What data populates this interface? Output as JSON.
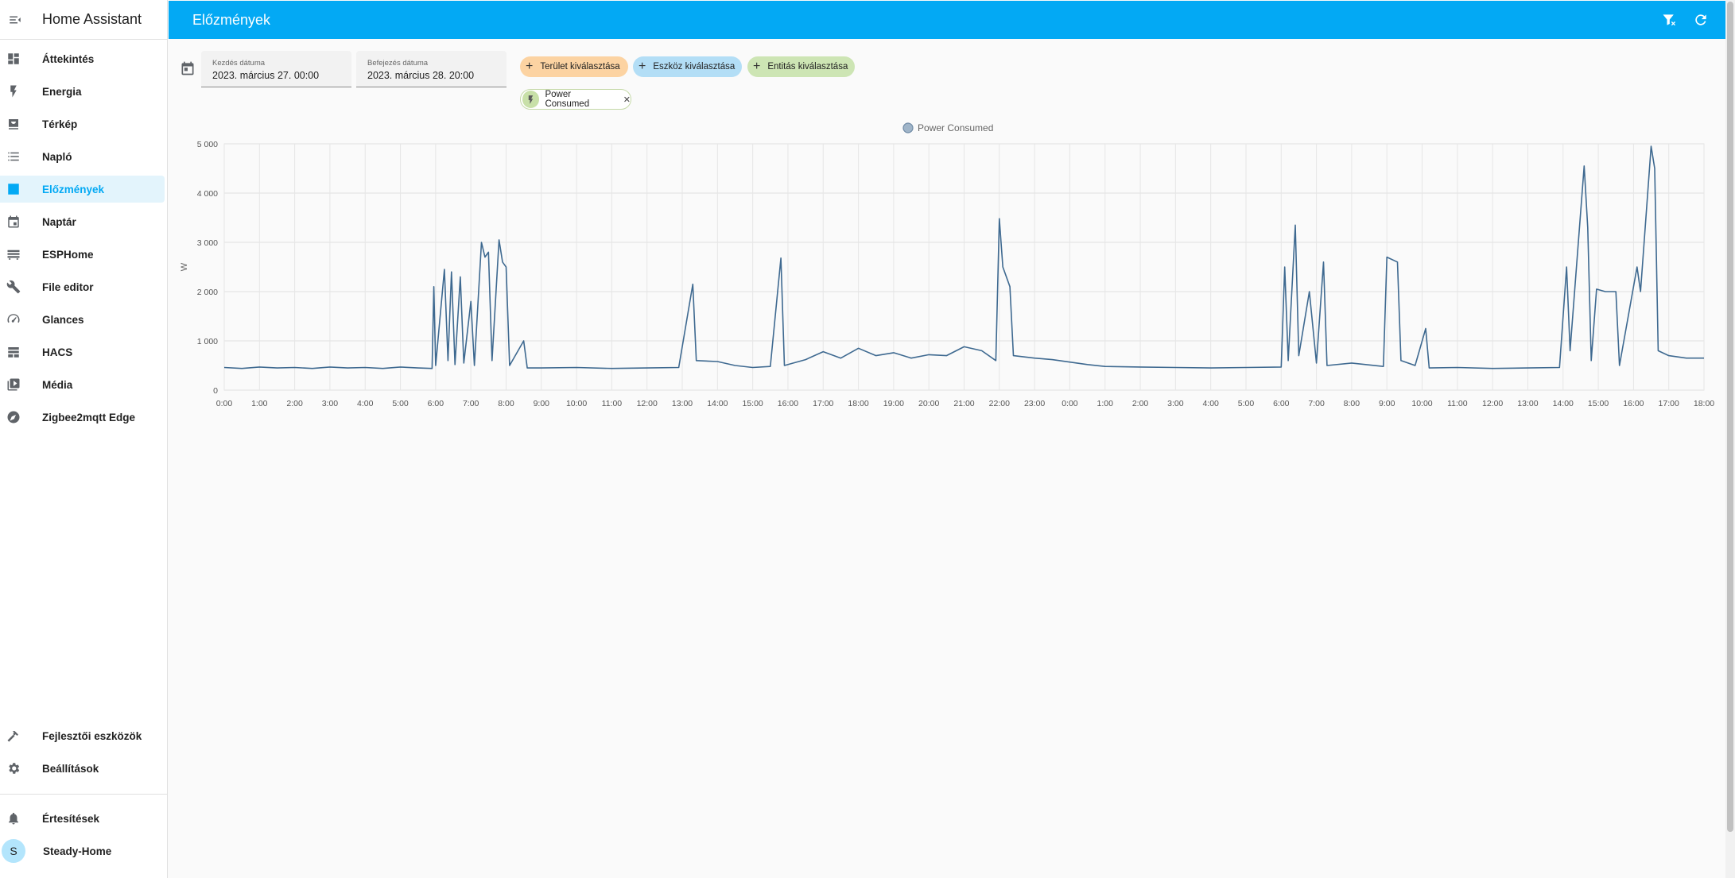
{
  "app": {
    "title": "Home Assistant"
  },
  "sidebar": {
    "items": [
      {
        "label": "Áttekintés",
        "icon": "dashboard-icon",
        "active": false
      },
      {
        "label": "Energia",
        "icon": "lightning-icon",
        "active": false
      },
      {
        "label": "Térkép",
        "icon": "map-icon",
        "active": false
      },
      {
        "label": "Napló",
        "icon": "list-icon",
        "active": false
      },
      {
        "label": "Előzmények",
        "icon": "chart-icon",
        "active": true
      },
      {
        "label": "Naptár",
        "icon": "calendar-icon",
        "active": false
      },
      {
        "label": "ESPHome",
        "icon": "chip-icon",
        "active": false
      },
      {
        "label": "File editor",
        "icon": "wrench-icon",
        "active": false
      },
      {
        "label": "Glances",
        "icon": "gauge-icon",
        "active": false
      },
      {
        "label": "HACS",
        "icon": "hacs-icon",
        "active": false
      },
      {
        "label": "Média",
        "icon": "media-icon",
        "active": false
      },
      {
        "label": "Zigbee2mqtt Edge",
        "icon": "compass-icon",
        "active": false
      }
    ],
    "bottom": [
      {
        "label": "Fejlesztői eszközök",
        "icon": "hammer-icon"
      },
      {
        "label": "Beállítások",
        "icon": "gear-icon"
      }
    ],
    "notifications_label": "Értesítések",
    "user": {
      "initial": "S",
      "name": "Steady-Home"
    }
  },
  "header": {
    "title": "Előzmények"
  },
  "filters": {
    "start": {
      "label": "Kezdés dátuma",
      "value": "2023. március 27. 00:00"
    },
    "end": {
      "label": "Befejezés dátuma",
      "value": "2023. március 28. 20:00"
    },
    "chips": {
      "area": "Terület kiválasztása",
      "device": "Eszköz kiválasztása",
      "entity": "Entitás kiválasztása"
    },
    "selected_entity": "Power Consumed"
  },
  "colors": {
    "accent": "#03a9f4",
    "series": "#3e6990"
  },
  "chart_data": {
    "type": "line",
    "ylabel": "W",
    "ylim": [
      0,
      5000
    ],
    "yticks": [
      "0",
      "1 000",
      "2 000",
      "3 000",
      "4 000",
      "5 000"
    ],
    "xticks": [
      "0:00",
      "1:00",
      "2:00",
      "3:00",
      "4:00",
      "5:00",
      "6:00",
      "7:00",
      "8:00",
      "9:00",
      "10:00",
      "11:00",
      "12:00",
      "13:00",
      "14:00",
      "15:00",
      "16:00",
      "17:00",
      "18:00",
      "19:00",
      "20:00",
      "21:00",
      "22:00",
      "23:00",
      "0:00",
      "1:00",
      "2:00",
      "3:00",
      "4:00",
      "5:00",
      "6:00",
      "7:00",
      "8:00",
      "9:00",
      "10:00",
      "11:00",
      "12:00",
      "13:00",
      "14:00",
      "15:00",
      "16:00",
      "17:00",
      "18:00"
    ],
    "grid": true,
    "legend_position": "top-center",
    "series": [
      {
        "name": "Power Consumed",
        "points": [
          [
            0,
            460
          ],
          [
            0.5,
            440
          ],
          [
            1,
            470
          ],
          [
            1.5,
            450
          ],
          [
            2,
            460
          ],
          [
            2.5,
            440
          ],
          [
            3,
            470
          ],
          [
            3.5,
            450
          ],
          [
            4,
            460
          ],
          [
            4.5,
            440
          ],
          [
            5,
            470
          ],
          [
            5.5,
            450
          ],
          [
            5.9,
            440
          ],
          [
            5.95,
            2100
          ],
          [
            6.0,
            500
          ],
          [
            6.25,
            2450
          ],
          [
            6.35,
            600
          ],
          [
            6.45,
            2400
          ],
          [
            6.55,
            520
          ],
          [
            6.7,
            2300
          ],
          [
            6.8,
            550
          ],
          [
            7.0,
            1800
          ],
          [
            7.1,
            500
          ],
          [
            7.3,
            3000
          ],
          [
            7.4,
            2700
          ],
          [
            7.5,
            2800
          ],
          [
            7.6,
            600
          ],
          [
            7.8,
            3050
          ],
          [
            7.9,
            2600
          ],
          [
            8.0,
            2500
          ],
          [
            8.1,
            500
          ],
          [
            8.5,
            1000
          ],
          [
            8.6,
            450
          ],
          [
            9,
            450
          ],
          [
            10,
            460
          ],
          [
            11,
            440
          ],
          [
            12,
            450
          ],
          [
            12.9,
            460
          ],
          [
            13.3,
            2150
          ],
          [
            13.4,
            600
          ],
          [
            14,
            580
          ],
          [
            14.5,
            500
          ],
          [
            15,
            460
          ],
          [
            15.5,
            480
          ],
          [
            15.8,
            2680
          ],
          [
            15.9,
            500
          ],
          [
            16.5,
            620
          ],
          [
            17,
            780
          ],
          [
            17.5,
            650
          ],
          [
            18,
            850
          ],
          [
            18.5,
            700
          ],
          [
            19,
            760
          ],
          [
            19.5,
            650
          ],
          [
            20,
            720
          ],
          [
            20.5,
            700
          ],
          [
            21,
            880
          ],
          [
            21.5,
            800
          ],
          [
            21.9,
            600
          ],
          [
            22.0,
            3480
          ],
          [
            22.1,
            2500
          ],
          [
            22.3,
            2100
          ],
          [
            22.4,
            700
          ],
          [
            23,
            650
          ],
          [
            23.5,
            620
          ],
          [
            24,
            570
          ],
          [
            24.5,
            520
          ],
          [
            25,
            480
          ],
          [
            26,
            470
          ],
          [
            27,
            460
          ],
          [
            28,
            450
          ],
          [
            29,
            460
          ],
          [
            30,
            470
          ],
          [
            30.1,
            2500
          ],
          [
            30.2,
            600
          ],
          [
            30.4,
            3350
          ],
          [
            30.5,
            700
          ],
          [
            30.8,
            2000
          ],
          [
            31,
            550
          ],
          [
            31.2,
            2600
          ],
          [
            31.3,
            500
          ],
          [
            32,
            550
          ],
          [
            32.9,
            480
          ],
          [
            33.0,
            2700
          ],
          [
            33.3,
            2600
          ],
          [
            33.4,
            600
          ],
          [
            33.8,
            500
          ],
          [
            34.1,
            1250
          ],
          [
            34.2,
            450
          ],
          [
            35,
            460
          ],
          [
            36,
            440
          ],
          [
            37,
            450
          ],
          [
            37.9,
            460
          ],
          [
            38.1,
            2500
          ],
          [
            38.2,
            800
          ],
          [
            38.6,
            4550
          ],
          [
            38.7,
            3300
          ],
          [
            38.8,
            600
          ],
          [
            38.95,
            2050
          ],
          [
            39.2,
            2000
          ],
          [
            39.5,
            2000
          ],
          [
            39.6,
            500
          ],
          [
            40.1,
            2500
          ],
          [
            40.2,
            2000
          ],
          [
            40.5,
            4950
          ],
          [
            40.6,
            4500
          ],
          [
            40.7,
            800
          ],
          [
            41.0,
            700
          ],
          [
            41.5,
            650
          ],
          [
            42,
            650
          ]
        ]
      }
    ]
  }
}
